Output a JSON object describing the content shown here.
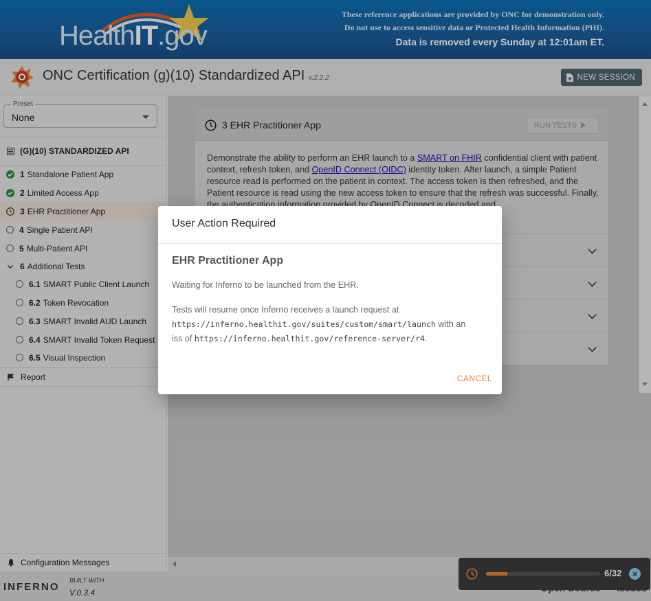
{
  "banner": {
    "logo_main": "Health",
    "logo_bold": "IT",
    "logo_tail": ".gov",
    "notice_line1": "These reference applications are provided by ONC for demonstration only.",
    "notice_line2": "Do not use to access sensitive data or Protected Health Information (PHI).",
    "notice_line3": "Data is removed every Sunday at 12:01am ET."
  },
  "header": {
    "title": "ONC Certification (g)(10) Standardized API",
    "version": "v.2.2.2",
    "new_session_label": "NEW SESSION"
  },
  "sidebar": {
    "preset_label": "Preset",
    "preset_value": "None",
    "suite_title": "(G)(10) STANDARDIZED API",
    "items": [
      {
        "num": "1",
        "label": "Standalone Patient App",
        "status": "pass"
      },
      {
        "num": "2",
        "label": "Limited Access App",
        "status": "pass"
      },
      {
        "num": "3",
        "label": "EHR Practitioner App",
        "status": "running"
      },
      {
        "num": "4",
        "label": "Single Patient API",
        "status": "none"
      },
      {
        "num": "5",
        "label": "Multi-Patient API",
        "status": "none"
      },
      {
        "num": "6",
        "label": "Additional Tests",
        "status": "expanded"
      },
      {
        "num": "6.1",
        "label": "SMART Public Client Launch",
        "status": "none"
      },
      {
        "num": "6.2",
        "label": "Token Revocation",
        "status": "none"
      },
      {
        "num": "6.3",
        "label": "SMART Invalid AUD Launch",
        "status": "none"
      },
      {
        "num": "6.4",
        "label": "SMART Invalid Token Request",
        "status": "none"
      },
      {
        "num": "6.5",
        "label": "Visual Inspection",
        "status": "none"
      }
    ],
    "report_label": "Report",
    "config_label": "Configuration Messages"
  },
  "main": {
    "card_title": "3 EHR Practitioner App",
    "run_tests_label": "RUN TESTS",
    "desc_part1": "Demonstrate the ability to perform an EHR launch to a ",
    "desc_link1": "SMART on FHIR",
    "desc_part2": " confidential client with patient context, refresh token, and ",
    "desc_link2": "OpenID Connect (OIDC)",
    "desc_part3": " identity token. After launch, a simple Patient resource read is performed on the patient in context. The access token is then refreshed, and the Patient resource is read using the new access token to ensure that the refresh was successful. Finally, the authentication information provided by OpenID Connect is decoded and"
  },
  "dialog": {
    "title": "User Action Required",
    "heading": "EHR Practitioner App",
    "waiting": "Waiting for Inferno to be launched from the EHR.",
    "resume_prefix": "Tests will resume once Inferno receives a launch request at",
    "launch_url": "https://inferno.healthit.gov/suites/custom/smart/launch",
    "with_an": "with an",
    "iss_of": "iss of",
    "iss_url": "https://inferno.healthit.gov/reference-server/r4",
    "period": ".",
    "cancel_label": "CANCEL"
  },
  "progress": {
    "count": "6/32",
    "fraction": 0.1875
  },
  "footer": {
    "inferno_brand": "INFERNO",
    "built_with": "BUILT WITH",
    "version": "V.0.3.4",
    "open_source": "Open Source",
    "issues": "Issues"
  },
  "colors": {
    "accent": "#e8833a",
    "pass": "#2e8b3a",
    "banner": "#1a5e9c"
  }
}
